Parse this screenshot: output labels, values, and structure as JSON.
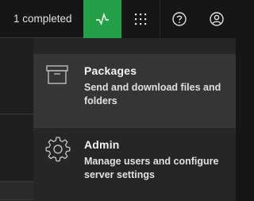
{
  "header": {
    "status_text": "1 completed",
    "icons": {
      "activity": "activity-pulse-icon",
      "apps": "app-switcher-grid-icon",
      "help": "help-icon",
      "user": "user-avatar-icon"
    },
    "colors": {
      "activity_bg": "#24a148",
      "header_bg": "#161616"
    }
  },
  "menu": {
    "items": [
      {
        "title": "Packages",
        "description": "Send and download files and folders",
        "icon": "package-box-icon"
      },
      {
        "title": "Admin",
        "description": "Manage users and configure server settings",
        "icon": "settings-gear-icon"
      }
    ]
  }
}
